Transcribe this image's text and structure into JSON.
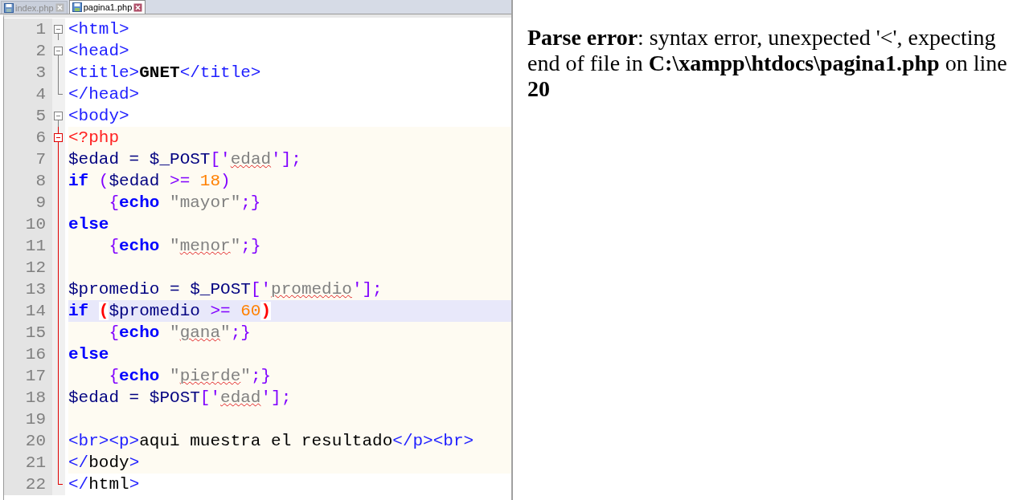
{
  "tabs": [
    {
      "label": "index.php",
      "selected": false
    },
    {
      "label": "pagina1.php",
      "selected": true
    }
  ],
  "editor": {
    "lines": [
      {
        "number": "1",
        "fold_start": true,
        "fold_end": false,
        "php_fold": false,
        "embedded": false,
        "current": false,
        "tokens": [
          {
            "text": "<html>",
            "kind": "tag"
          }
        ]
      },
      {
        "number": "2",
        "fold_start": true,
        "fold_end": false,
        "php_fold": false,
        "embedded": false,
        "current": false,
        "tokens": [
          {
            "text": "<head>",
            "kind": "tag"
          }
        ]
      },
      {
        "number": "3",
        "fold_start": false,
        "fold_end": false,
        "php_fold": false,
        "embedded": false,
        "current": false,
        "tokens": [
          {
            "text": "<title>",
            "kind": "tag"
          },
          {
            "text": "GNET",
            "kind": "bold"
          },
          {
            "text": "</title>",
            "kind": "tag"
          }
        ]
      },
      {
        "number": "4",
        "fold_start": false,
        "fold_end": true,
        "php_fold": false,
        "embedded": false,
        "current": false,
        "tokens": [
          {
            "text": "</head>",
            "kind": "tag"
          }
        ]
      },
      {
        "number": "5",
        "fold_start": true,
        "fold_end": false,
        "php_fold": false,
        "embedded": false,
        "current": false,
        "tokens": [
          {
            "text": "<body>",
            "kind": "tag"
          }
        ]
      },
      {
        "number": "6",
        "fold_start": true,
        "fold_end": false,
        "php_fold": true,
        "embedded": true,
        "current": false,
        "tokens": [
          {
            "text": "<?php",
            "kind": "php"
          }
        ]
      },
      {
        "number": "7",
        "fold_start": false,
        "fold_end": false,
        "php_fold": true,
        "embedded": true,
        "current": false,
        "tokens": [
          {
            "text": "$edad",
            "kind": "var"
          },
          {
            "text": " = ",
            "kind": "plain"
          },
          {
            "text": "$_POST",
            "kind": "var"
          },
          {
            "text": "['",
            "kind": "brace"
          },
          {
            "text": "edad",
            "kind": "misspelled"
          },
          {
            "text": "'];",
            "kind": "brace"
          }
        ]
      },
      {
        "number": "8",
        "fold_start": false,
        "fold_end": false,
        "php_fold": true,
        "embedded": true,
        "current": false,
        "tokens": [
          {
            "text": "if ",
            "kind": "keyword"
          },
          {
            "text": "(",
            "kind": "brace"
          },
          {
            "text": "$edad",
            "kind": "var"
          },
          {
            "text": " >= ",
            "kind": "brace"
          },
          {
            "text": "18",
            "kind": "number"
          },
          {
            "text": ")",
            "kind": "brace"
          }
        ]
      },
      {
        "number": "9",
        "fold_start": false,
        "fold_end": false,
        "php_fold": true,
        "embedded": true,
        "current": false,
        "tokens": [
          {
            "text": "    {",
            "kind": "brace"
          },
          {
            "text": "echo ",
            "kind": "keyword"
          },
          {
            "text": "\"mayor\"",
            "kind": "string"
          },
          {
            "text": ";}",
            "kind": "brace"
          }
        ]
      },
      {
        "number": "10",
        "fold_start": false,
        "fold_end": false,
        "php_fold": true,
        "embedded": true,
        "current": false,
        "tokens": [
          {
            "text": "else",
            "kind": "keyword"
          }
        ]
      },
      {
        "number": "11",
        "fold_start": false,
        "fold_end": false,
        "php_fold": true,
        "embedded": true,
        "current": false,
        "tokens": [
          {
            "text": "    {",
            "kind": "brace"
          },
          {
            "text": "echo",
            "kind": "keyword"
          },
          {
            "text": " \"",
            "kind": "string"
          },
          {
            "text": "menor",
            "kind": "misspelled"
          },
          {
            "text": "\"",
            "kind": "string"
          },
          {
            "text": ";}",
            "kind": "brace"
          }
        ]
      },
      {
        "number": "12",
        "fold_start": false,
        "fold_end": false,
        "php_fold": true,
        "embedded": true,
        "current": false
      },
      {
        "number": "13",
        "fold_start": false,
        "fold_end": false,
        "php_fold": true,
        "embedded": true,
        "current": false,
        "tokens": [
          {
            "text": "$promedio",
            "kind": "var"
          },
          {
            "text": " = ",
            "kind": "plain"
          },
          {
            "text": "$_POST",
            "kind": "var"
          },
          {
            "text": "['",
            "kind": "brace"
          },
          {
            "text": "promedio",
            "kind": "misspelled"
          },
          {
            "text": "'];",
            "kind": "brace"
          }
        ]
      },
      {
        "number": "14",
        "fold_start": false,
        "fold_end": false,
        "php_fold": true,
        "embedded": true,
        "current": true,
        "tokens": [
          {
            "text": "if ",
            "kind": "keyword"
          },
          {
            "text": "(",
            "kind": "match"
          },
          {
            "text": "$promedio",
            "kind": "var"
          },
          {
            "text": " >= ",
            "kind": "brace"
          },
          {
            "text": "60",
            "kind": "number"
          },
          {
            "text": ")",
            "kind": "match"
          }
        ]
      },
      {
        "number": "15",
        "fold_start": false,
        "fold_end": false,
        "php_fold": true,
        "embedded": true,
        "current": false,
        "tokens": [
          {
            "text": "    {",
            "kind": "brace"
          },
          {
            "text": "echo",
            "kind": "keyword"
          },
          {
            "text": " \"",
            "kind": "string"
          },
          {
            "text": "gana",
            "kind": "misspelled"
          },
          {
            "text": "\"",
            "kind": "string"
          },
          {
            "text": ";}",
            "kind": "brace"
          }
        ]
      },
      {
        "number": "16",
        "fold_start": false,
        "fold_end": false,
        "php_fold": true,
        "embedded": true,
        "current": false,
        "tokens": [
          {
            "text": "else",
            "kind": "keyword"
          }
        ]
      },
      {
        "number": "17",
        "fold_start": false,
        "fold_end": false,
        "php_fold": true,
        "embedded": true,
        "current": false,
        "tokens": [
          {
            "text": "    {",
            "kind": "brace"
          },
          {
            "text": "echo",
            "kind": "keyword"
          },
          {
            "text": " \"",
            "kind": "string"
          },
          {
            "text": "pierde",
            "kind": "misspelled"
          },
          {
            "text": "\"",
            "kind": "string"
          },
          {
            "text": ";}",
            "kind": "brace"
          }
        ]
      },
      {
        "number": "18",
        "fold_start": false,
        "fold_end": false,
        "php_fold": true,
        "embedded": true,
        "current": false,
        "tokens": [
          {
            "text": "$edad",
            "kind": "var"
          },
          {
            "text": " = ",
            "kind": "plain"
          },
          {
            "text": "$POST",
            "kind": "var"
          },
          {
            "text": "['",
            "kind": "brace"
          },
          {
            "text": "edad",
            "kind": "misspelled"
          },
          {
            "text": "'];",
            "kind": "brace"
          }
        ]
      },
      {
        "number": "19",
        "fold_start": false,
        "fold_end": false,
        "php_fold": true,
        "embedded": true,
        "current": false
      },
      {
        "number": "20",
        "fold_start": false,
        "fold_end": false,
        "php_fold": true,
        "embedded": true,
        "current": false,
        "tokens": [
          {
            "text": "<br><p>",
            "kind": "tag"
          },
          {
            "text": "aqui muestra el resultado",
            "kind": "text"
          },
          {
            "text": "</p><br>",
            "kind": "tag"
          }
        ]
      },
      {
        "number": "21",
        "fold_start": false,
        "fold_end": false,
        "php_fold": true,
        "embedded": true,
        "current": false,
        "tokens": [
          {
            "text": "</",
            "kind": "tag"
          },
          {
            "text": "body",
            "kind": "text"
          },
          {
            "text": ">",
            "kind": "tag"
          }
        ]
      },
      {
        "number": "22",
        "fold_start": false,
        "fold_end": true,
        "php_fold": true,
        "embedded": false,
        "current": false,
        "tokens": [
          {
            "text": "</",
            "kind": "tag"
          },
          {
            "text": "html",
            "kind": "text"
          },
          {
            "text": ">",
            "kind": "tag"
          }
        ]
      }
    ]
  },
  "browser": {
    "message": "**Parse error**: syntax error, unexpected '<', expecting end of file in **C:\\xampp\\htdocs\\pagina1.php** on line **20**"
  }
}
